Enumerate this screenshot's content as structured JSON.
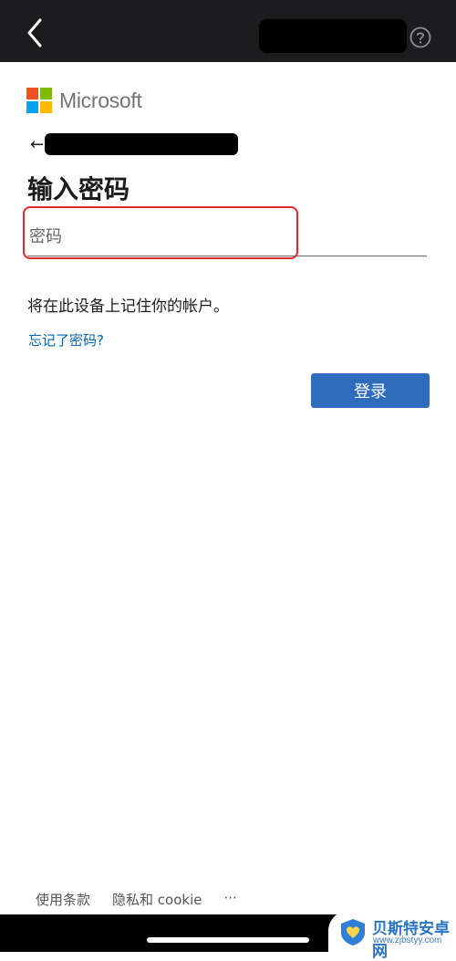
{
  "brand": {
    "name": "Microsoft"
  },
  "page": {
    "title": "输入密码",
    "password_placeholder": "密码",
    "remember_text": "将在此设备上记住你的帐户。",
    "forgot_link": "忘记了密码?",
    "signin_button": "登录",
    "back_arrow": "←"
  },
  "footer": {
    "terms": "使用条款",
    "privacy": "隐私和 cookie",
    "more": "···"
  },
  "watermark": {
    "title": "贝斯特安卓网",
    "url": "www.zjbstyy.com"
  },
  "colors": {
    "accent": "#2f6cbe",
    "link": "#0067b8",
    "highlight": "#e0262f",
    "topbar": "#1c1c1e"
  },
  "icons": {
    "back": "chevron-left-icon",
    "help": "question-circle-icon",
    "logo": "microsoft-logo-icon"
  }
}
